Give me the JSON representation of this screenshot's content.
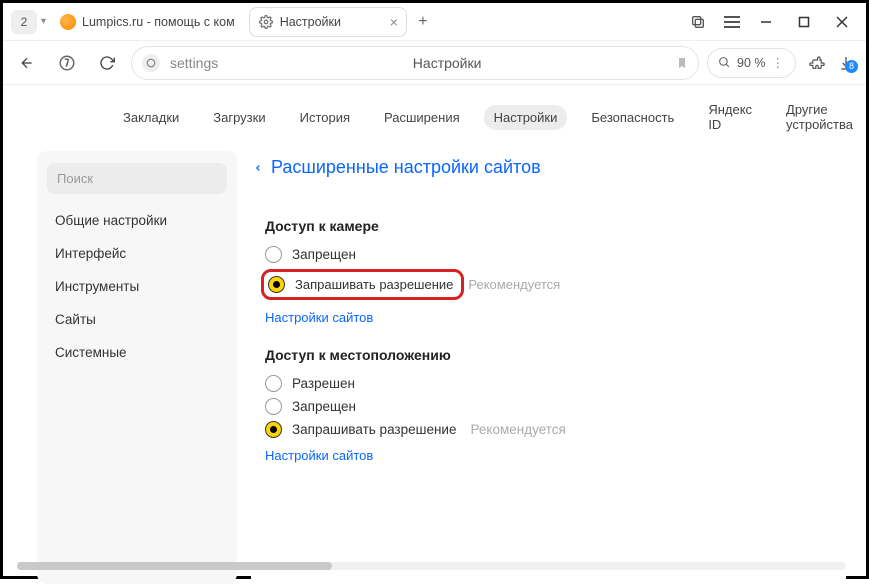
{
  "titlebar": {
    "group_count": "2",
    "tabs": [
      {
        "label": "Lumpics.ru - помощь с ком"
      },
      {
        "label": "Настройки"
      }
    ],
    "download_count": "8"
  },
  "addressbar": {
    "url": "settings",
    "title": "Настройки",
    "zoom": "90 %"
  },
  "topnav": {
    "items": [
      "Закладки",
      "Загрузки",
      "История",
      "Расширения",
      "Настройки",
      "Безопасность",
      "Яндекс ID",
      "Другие устройства"
    ],
    "active_index": 4
  },
  "sidebar": {
    "search_placeholder": "Поиск",
    "items": [
      "Общие настройки",
      "Интерфейс",
      "Инструменты",
      "Сайты",
      "Системные"
    ]
  },
  "panel": {
    "header": "Расширенные настройки сайтов",
    "sections": [
      {
        "title": "Доступ к камере",
        "options": [
          {
            "label": "Запрещен",
            "checked": false
          },
          {
            "label": "Запрашивать разрешение",
            "checked": true,
            "recommended": "Рекомендуется",
            "highlighted": true
          }
        ],
        "link": "Настройки сайтов"
      },
      {
        "title": "Доступ к местоположению",
        "options": [
          {
            "label": "Разрешен",
            "checked": false
          },
          {
            "label": "Запрещен",
            "checked": false
          },
          {
            "label": "Запрашивать разрешение",
            "checked": true,
            "recommended": "Рекомендуется"
          }
        ],
        "link": "Настройки сайтов"
      }
    ]
  }
}
